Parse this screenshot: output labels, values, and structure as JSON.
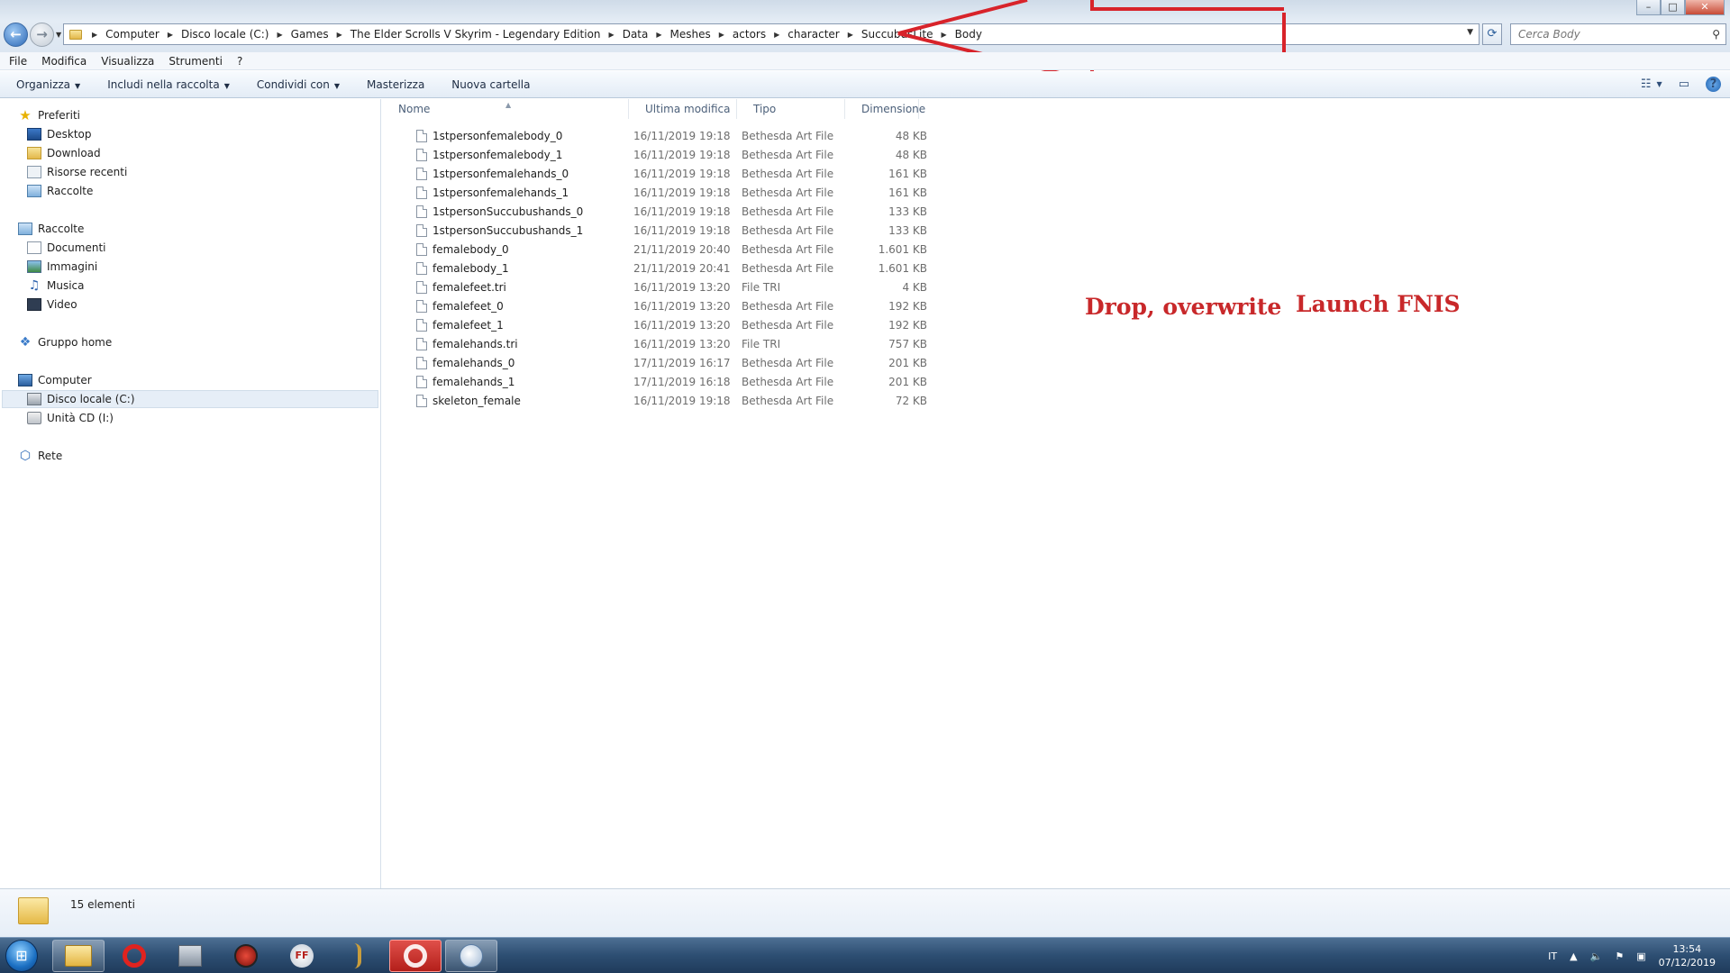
{
  "window": {
    "controls": [
      "–",
      "□",
      "✕"
    ]
  },
  "address": {
    "breadcrumbs": [
      "Computer",
      "Disco locale (C:)",
      "Games",
      "The Elder Scrolls V Skyrim - Legendary Edition",
      "Data",
      "Meshes",
      "actors",
      "character",
      "SuccubusLite",
      "Body"
    ]
  },
  "search": {
    "placeholder": "Cerca Body"
  },
  "menubar": [
    "File",
    "Modifica",
    "Visualizza",
    "Strumenti",
    "?"
  ],
  "commandbar": {
    "organize": "Organizza",
    "include": "Includi nella raccolta",
    "share": "Condividi con",
    "burn": "Masterizza",
    "new_folder": "Nuova cartella"
  },
  "nav": {
    "favorites": "Preferiti",
    "desktop": "Desktop",
    "download": "Download",
    "recent": "Risorse recenti",
    "fav_libraries": "Raccolte",
    "libraries": "Raccolte",
    "documents": "Documenti",
    "images": "Immagini",
    "music": "Musica",
    "video": "Video",
    "homegroup": "Gruppo home",
    "computer": "Computer",
    "local_disk": "Disco locale (C:)",
    "cd_drive": "Unità CD (I:)",
    "network": "Rete"
  },
  "columns": {
    "name": "Nome",
    "modified": "Ultima modifica",
    "type": "Tipo",
    "size": "Dimensione"
  },
  "files": [
    {
      "name": "1stpersonfemalebody_0",
      "date": "16/11/2019 19:18",
      "type": "Bethesda Art File",
      "size": "48 KB"
    },
    {
      "name": "1stpersonfemalebody_1",
      "date": "16/11/2019 19:18",
      "type": "Bethesda Art File",
      "size": "48 KB"
    },
    {
      "name": "1stpersonfemalehands_0",
      "date": "16/11/2019 19:18",
      "type": "Bethesda Art File",
      "size": "161 KB"
    },
    {
      "name": "1stpersonfemalehands_1",
      "date": "16/11/2019 19:18",
      "type": "Bethesda Art File",
      "size": "161 KB"
    },
    {
      "name": "1stpersonSuccubushands_0",
      "date": "16/11/2019 19:18",
      "type": "Bethesda Art File",
      "size": "133 KB"
    },
    {
      "name": "1stpersonSuccubushands_1",
      "date": "16/11/2019 19:18",
      "type": "Bethesda Art File",
      "size": "133 KB"
    },
    {
      "name": "femalebody_0",
      "date": "21/11/2019 20:40",
      "type": "Bethesda Art File",
      "size": "1.601 KB"
    },
    {
      "name": "femalebody_1",
      "date": "21/11/2019 20:41",
      "type": "Bethesda Art File",
      "size": "1.601 KB"
    },
    {
      "name": "femalefeet.tri",
      "date": "16/11/2019 13:20",
      "type": "File TRI",
      "size": "4 KB"
    },
    {
      "name": "femalefeet_0",
      "date": "16/11/2019 13:20",
      "type": "Bethesda Art File",
      "size": "192 KB"
    },
    {
      "name": "femalefeet_1",
      "date": "16/11/2019 13:20",
      "type": "Bethesda Art File",
      "size": "192 KB"
    },
    {
      "name": "femalehands.tri",
      "date": "16/11/2019 13:20",
      "type": "File TRI",
      "size": "757 KB"
    },
    {
      "name": "femalehands_0",
      "date": "17/11/2019 16:17",
      "type": "Bethesda Art File",
      "size": "201 KB"
    },
    {
      "name": "femalehands_1",
      "date": "17/11/2019 16:18",
      "type": "Bethesda Art File",
      "size": "201 KB"
    },
    {
      "name": "skeleton_female",
      "date": "16/11/2019 19:18",
      "type": "Bethesda Art File",
      "size": "72 KB"
    }
  ],
  "annotations": {
    "drop": "Drop, overwrite",
    "launch": "Launch FNIS"
  },
  "status": {
    "count": "15 elementi"
  },
  "taskbar": {
    "apps": [
      "explorer-icon",
      "opera-icon",
      "media-icon",
      "game-icon",
      "ffdec-icon",
      "bow-icon",
      "opera-active-icon",
      "paint-icon"
    ],
    "ffdec_label": "FF",
    "tray_lang": "IT",
    "time": "13:54",
    "date": "07/12/2019"
  },
  "colors": {
    "annotation": "#c8282a",
    "arrow": "#d8232a",
    "taskbar": "#2d4e72"
  }
}
